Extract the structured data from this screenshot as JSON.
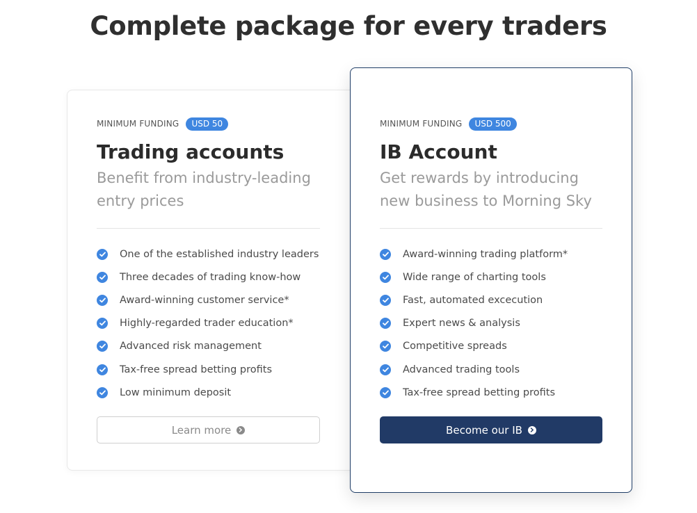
{
  "headline": {
    "highlight": "Complete",
    "rest": " package for every traders"
  },
  "colors": {
    "accent": "#3f86e0",
    "primary_button": "#213a66",
    "highlight": "#6f98bf"
  },
  "cards": [
    {
      "funding_label": "MINIMUM FUNDING",
      "funding_amount": "USD 50",
      "title": "Trading accounts",
      "subtitle": "Benefit from industry-leading entry prices",
      "features": [
        "One of the established industry leaders",
        "Three decades of trading know-how",
        "Award-winning customer service*",
        "Highly-regarded trader education*",
        "Advanced risk management",
        "Tax-free spread betting profits",
        "Low minimum deposit"
      ],
      "button_label": "Learn more",
      "button_icon": "chevron-right-circle-icon"
    },
    {
      "funding_label": "MINIMUM FUNDING",
      "funding_amount": "USD 500",
      "title": "IB Account",
      "subtitle": "Get rewards by introducing new business to Morning Sky",
      "features": [
        "Award-winning trading platform*",
        "Wide range of charting tools",
        "Fast, automated excecution",
        "Expert news & analysis",
        "Competitive spreads",
        "Advanced trading tools",
        "Tax-free spread betting profits"
      ],
      "button_label": "Become our IB",
      "button_icon": "chevron-right-circle-icon"
    }
  ]
}
